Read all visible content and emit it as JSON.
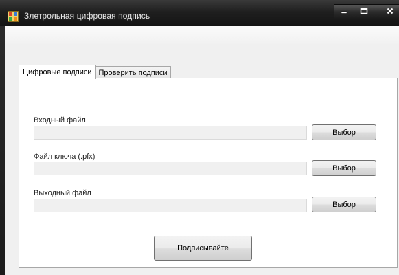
{
  "window": {
    "title": "Злетрольная цифровая подпись"
  },
  "tabs": [
    {
      "label": "Цифровые подписи",
      "active": true
    },
    {
      "label": "Проверить подписи",
      "active": false
    }
  ],
  "fields": [
    {
      "label": "Входный файл",
      "value": "",
      "button": "Выбор"
    },
    {
      "label": "Файл ключа (.pfx)",
      "value": "",
      "button": "Выбор"
    },
    {
      "label": "Выходный файл",
      "value": "",
      "button": "Выбор"
    }
  ],
  "sign_button": "Подписывайте",
  "icons": {
    "app": "app-icon",
    "minimize": "minimize-icon",
    "maximize": "maximize-icon",
    "close": "close-icon"
  }
}
